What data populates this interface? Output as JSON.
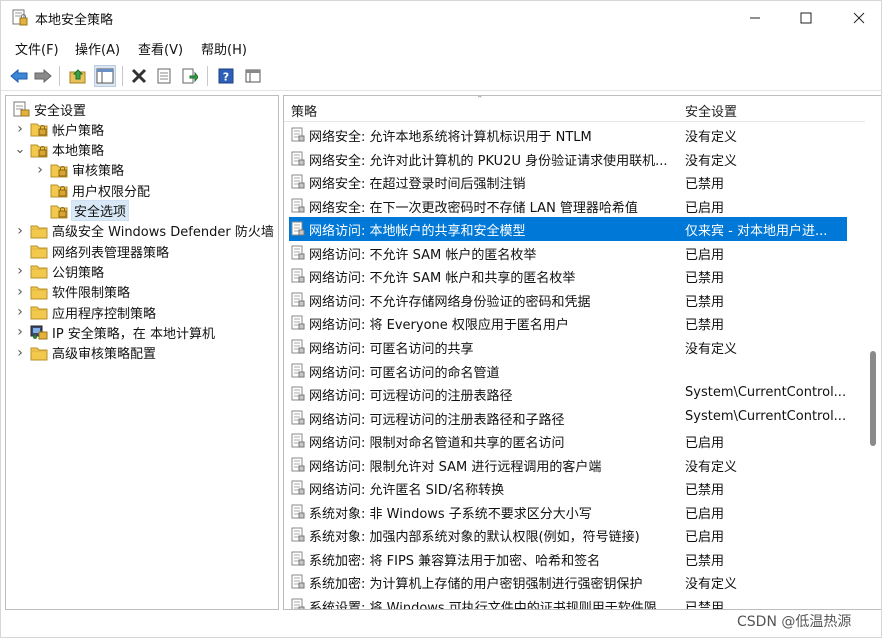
{
  "window": {
    "title": "本地安全策略",
    "icon": "security-policy-icon"
  },
  "menu": [
    "文件(F)",
    "操作(A)",
    "查看(V)",
    "帮助(H)"
  ],
  "toolbar": [
    "back-arrow-icon",
    "forward-arrow-icon",
    "up-folder-icon",
    "show-hide-tree-icon",
    "delete-icon",
    "properties-icon",
    "export-list-icon",
    "help-icon",
    "console-view-icon"
  ],
  "tree": [
    {
      "label": "安全设置",
      "depth": 0,
      "expander": "",
      "icon": "security-settings-icon"
    },
    {
      "label": "帐户策略",
      "depth": 1,
      "expander": ">",
      "icon": "folder-lock-icon"
    },
    {
      "label": "本地策略",
      "depth": 1,
      "expander": "v",
      "icon": "folder-lock-icon"
    },
    {
      "label": "审核策略",
      "depth": 2,
      "expander": ">",
      "icon": "folder-lock-icon"
    },
    {
      "label": "用户权限分配",
      "depth": 2,
      "expander": "",
      "icon": "folder-lock-icon"
    },
    {
      "label": "安全选项",
      "depth": 2,
      "expander": "",
      "icon": "folder-lock-icon",
      "selected": true
    },
    {
      "label": "高级安全 Windows Defender 防火墙",
      "depth": 1,
      "expander": ">",
      "icon": "folder-icon"
    },
    {
      "label": "网络列表管理器策略",
      "depth": 1,
      "expander": "",
      "icon": "folder-icon"
    },
    {
      "label": "公钥策略",
      "depth": 1,
      "expander": ">",
      "icon": "folder-icon"
    },
    {
      "label": "软件限制策略",
      "depth": 1,
      "expander": ">",
      "icon": "folder-icon"
    },
    {
      "label": "应用程序控制策略",
      "depth": 1,
      "expander": ">",
      "icon": "folder-icon"
    },
    {
      "label": "IP 安全策略，在 本地计算机",
      "depth": 1,
      "expander": ">",
      "icon": "ip-security-icon"
    },
    {
      "label": "高级审核策略配置",
      "depth": 1,
      "expander": ">",
      "icon": "folder-icon"
    }
  ],
  "list": {
    "columns": {
      "policy": "策略",
      "setting": "安全设置"
    },
    "rows": [
      {
        "policy": "网络安全: 允许本地系统将计算机标识用于 NTLM",
        "setting": "没有定义"
      },
      {
        "policy": "网络安全: 允许对此计算机的 PKU2U 身份验证请求使用联机...",
        "setting": "没有定义"
      },
      {
        "policy": "网络安全: 在超过登录时间后强制注销",
        "setting": "已禁用"
      },
      {
        "policy": "网络安全: 在下一次更改密码时不存储 LAN 管理器哈希值",
        "setting": "已启用"
      },
      {
        "policy": "网络访问: 本地帐户的共享和安全模型",
        "setting": "仅来宾 - 对本地用户进...",
        "selected": true
      },
      {
        "policy": "网络访问: 不允许 SAM 帐户的匿名枚举",
        "setting": "已启用"
      },
      {
        "policy": "网络访问: 不允许 SAM 帐户和共享的匿名枚举",
        "setting": "已禁用"
      },
      {
        "policy": "网络访问: 不允许存储网络身份验证的密码和凭据",
        "setting": "已禁用"
      },
      {
        "policy": "网络访问: 将 Everyone 权限应用于匿名用户",
        "setting": "已禁用"
      },
      {
        "policy": "网络访问: 可匿名访问的共享",
        "setting": "没有定义"
      },
      {
        "policy": "网络访问: 可匿名访问的命名管道",
        "setting": ""
      },
      {
        "policy": "网络访问: 可远程访问的注册表路径",
        "setting": "System\\CurrentControl..."
      },
      {
        "policy": "网络访问: 可远程访问的注册表路径和子路径",
        "setting": "System\\CurrentControl..."
      },
      {
        "policy": "网络访问: 限制对命名管道和共享的匿名访问",
        "setting": "已启用"
      },
      {
        "policy": "网络访问: 限制允许对 SAM 进行远程调用的客户端",
        "setting": "没有定义"
      },
      {
        "policy": "网络访问: 允许匿名 SID/名称转换",
        "setting": "已禁用"
      },
      {
        "policy": "系统对象: 非 Windows 子系统不要求区分大小写",
        "setting": "已启用"
      },
      {
        "policy": "系统对象: 加强内部系统对象的默认权限(例如，符号链接)",
        "setting": "已启用"
      },
      {
        "policy": "系统加密: 将 FIPS 兼容算法用于加密、哈希和签名",
        "setting": "已禁用"
      },
      {
        "policy": "系统加密: 为计算机上存储的用户密钥强制进行强密钥保护",
        "setting": "没有定义"
      },
      {
        "policy": "系统设置: 将 Windows 可执行文件中的证书规则用于软件限",
        "setting": "已禁用"
      }
    ]
  },
  "watermark": "CSDN @低温热源",
  "accent": "#0078d7"
}
